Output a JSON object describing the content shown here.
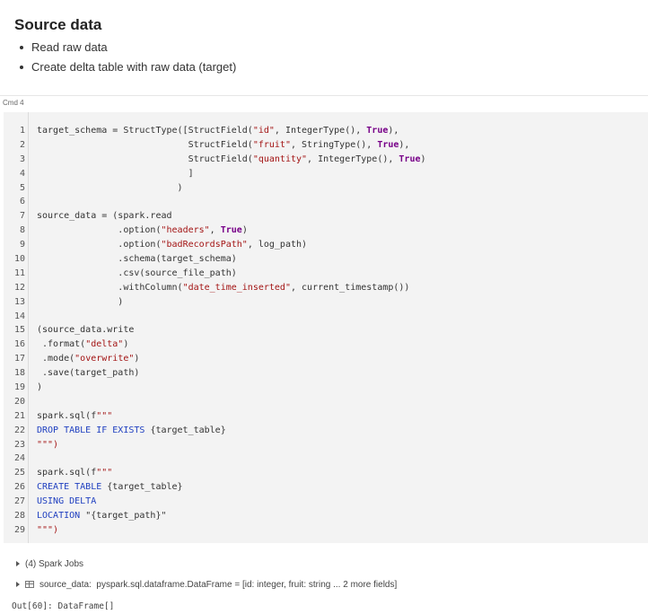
{
  "markdown": {
    "title": "Source data",
    "bullets": [
      "Read raw data",
      "Create delta table with raw data (target)"
    ]
  },
  "cell": {
    "cmd_label": "Cmd 4"
  },
  "code_lines": [
    [
      {
        "t": "target_schema = StructType([StructField("
      },
      {
        "t": "\"id\"",
        "c": "str"
      },
      {
        "t": ", IntegerType(), "
      },
      {
        "t": "True",
        "c": "kw"
      },
      {
        "t": "),"
      }
    ],
    [
      {
        "t": "                            StructField("
      },
      {
        "t": "\"fruit\"",
        "c": "str"
      },
      {
        "t": ", StringType(), "
      },
      {
        "t": "True",
        "c": "kw"
      },
      {
        "t": "),"
      }
    ],
    [
      {
        "t": "                            StructField("
      },
      {
        "t": "\"quantity\"",
        "c": "str"
      },
      {
        "t": ", IntegerType(), "
      },
      {
        "t": "True",
        "c": "kw"
      },
      {
        "t": ")"
      }
    ],
    [
      {
        "t": "                            ]"
      }
    ],
    [
      {
        "t": "                          )"
      }
    ],
    [],
    [
      {
        "t": "source_data = (spark.read"
      }
    ],
    [
      {
        "t": "               .option("
      },
      {
        "t": "\"headers\"",
        "c": "str"
      },
      {
        "t": ", "
      },
      {
        "t": "True",
        "c": "kw"
      },
      {
        "t": ")"
      }
    ],
    [
      {
        "t": "               .option("
      },
      {
        "t": "\"badRecordsPath\"",
        "c": "str"
      },
      {
        "t": ", log_path)"
      }
    ],
    [
      {
        "t": "               .schema(target_schema)"
      }
    ],
    [
      {
        "t": "               .csv(source_file_path)"
      }
    ],
    [
      {
        "t": "               .withColumn("
      },
      {
        "t": "\"date_time_inserted\"",
        "c": "str"
      },
      {
        "t": ", current_timestamp())"
      }
    ],
    [
      {
        "t": "               )"
      }
    ],
    [],
    [
      {
        "t": "(source_data.write"
      }
    ],
    [
      {
        "t": " .format("
      },
      {
        "t": "\"delta\"",
        "c": "str"
      },
      {
        "t": ")"
      }
    ],
    [
      {
        "t": " .mode("
      },
      {
        "t": "\"overwrite\"",
        "c": "str"
      },
      {
        "t": ")"
      }
    ],
    [
      {
        "t": " .save(target_path)"
      }
    ],
    [
      {
        "t": ")"
      }
    ],
    [],
    [
      {
        "t": "spark.sql(f"
      },
      {
        "t": "\"\"\"",
        "c": "str"
      }
    ],
    [
      {
        "t": "DROP TABLE IF EXISTS ",
        "c": "sql"
      },
      {
        "t": "{target_table}"
      }
    ],
    [
      {
        "t": "\"\"\")",
        "c": "str"
      }
    ],
    [],
    [
      {
        "t": "spark.sql(f"
      },
      {
        "t": "\"\"\"",
        "c": "str"
      }
    ],
    [
      {
        "t": "CREATE TABLE ",
        "c": "sql"
      },
      {
        "t": "{target_table}"
      }
    ],
    [
      {
        "t": "USING DELTA",
        "c": "sql"
      }
    ],
    [
      {
        "t": "LOCATION ",
        "c": "sql"
      },
      {
        "t": "\"{target_path}\""
      }
    ],
    [
      {
        "t": "\"\"\")",
        "c": "str"
      }
    ]
  ],
  "output": {
    "spark_jobs": "(4) Spark Jobs",
    "dataframe_name": "source_data:",
    "dataframe_type": "pyspark.sql.dataframe.DataFrame = [id: integer, fruit: string ... 2 more fields]",
    "out_text": "Out[60]: DataFrame[]"
  },
  "icons": {
    "expand": "triangle-right-icon",
    "dataframe": "table-icon"
  }
}
